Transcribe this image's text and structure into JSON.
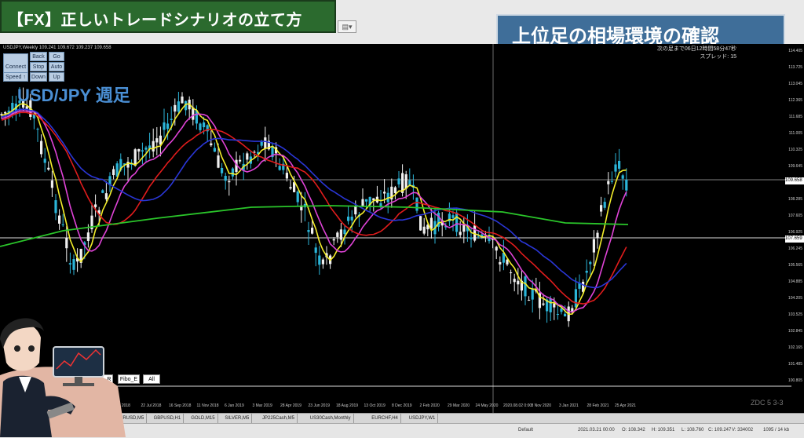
{
  "title": "【FX】正しいトレードシナリオの立て方",
  "subtitle": "上位足の相場環境の確認",
  "chart_header": "USDJPY,Weekly 109.241 109.672 109.237 109.658",
  "symbol_label": "USD/JPY 週足",
  "corner_info": [
    "次の足まで06日12時間58分47秒",
    "スプレッド: 15"
  ],
  "panel_buttons": [
    {
      "label": "Connect"
    },
    {
      "label": "Back"
    },
    {
      "label": "Go"
    },
    {
      "label": "Stop"
    },
    {
      "label": "Auto"
    },
    {
      "label": "Speed ↑"
    },
    {
      "label": "Down"
    },
    {
      "label": "Up"
    }
  ],
  "bottom_buttons": [
    "p_R",
    "Fibo_E",
    "All"
  ],
  "price_axis": [
    "114.405",
    "113.725",
    "113.045",
    "112.365",
    "111.685",
    "111.005",
    "110.325",
    "109.645",
    "108.965",
    "108.285",
    "107.605",
    "106.925",
    "106.245",
    "105.565",
    "104.885",
    "104.205",
    "103.525",
    "102.845",
    "102.165",
    "101.485",
    "100.805"
  ],
  "price_tags": {
    "current": "109.658",
    "hline": "107.659"
  },
  "date_axis": [
    "May 2018",
    "22 Jul 2018",
    "16 Sep 2018",
    "11 Nov 2018",
    "6 Jan 2019",
    "3 Mar 2019",
    "28 Apr 2019",
    "23 Jun 2019",
    "18 Aug 2019",
    "13 Oct 2019",
    "8 Dec 2019",
    "2 Feb 2020",
    "29 Mar 2020",
    "24 May 2020",
    "2020.08.02 0:00",
    "8 Nov 2020",
    "3 Jan 2021",
    "28 Feb 2021",
    "25 Apr 2021"
  ],
  "tabs": [
    "EURUSD,M5",
    "GBPUSD,H1",
    "GOLD,M15",
    "SILVER,M5",
    "JP225Cash,M5",
    "US30Cash,Monthly",
    "EURCHF,H4",
    "USDJPY,W1"
  ],
  "status": [
    "Default",
    "2021.03.21 00:00",
    "O: 108.342",
    "H: 109.351",
    "L: 108.760",
    "C: 109.247",
    "V: 334002",
    "1095 / 14 kb"
  ],
  "watermark": "ZDC 5 3-3",
  "colors": {
    "bull": "#2bb5d8",
    "bear": "#f0f0f0",
    "ma_fast": "#f5ef2a",
    "ma_mid": "#e043d8",
    "ma_red": "#e01c1c",
    "ma_blue": "#2a36d6",
    "ma_green": "#2ac52a",
    "title_bg": "#2b6a2e",
    "subtitle_bg": "#3f6e99"
  }
}
